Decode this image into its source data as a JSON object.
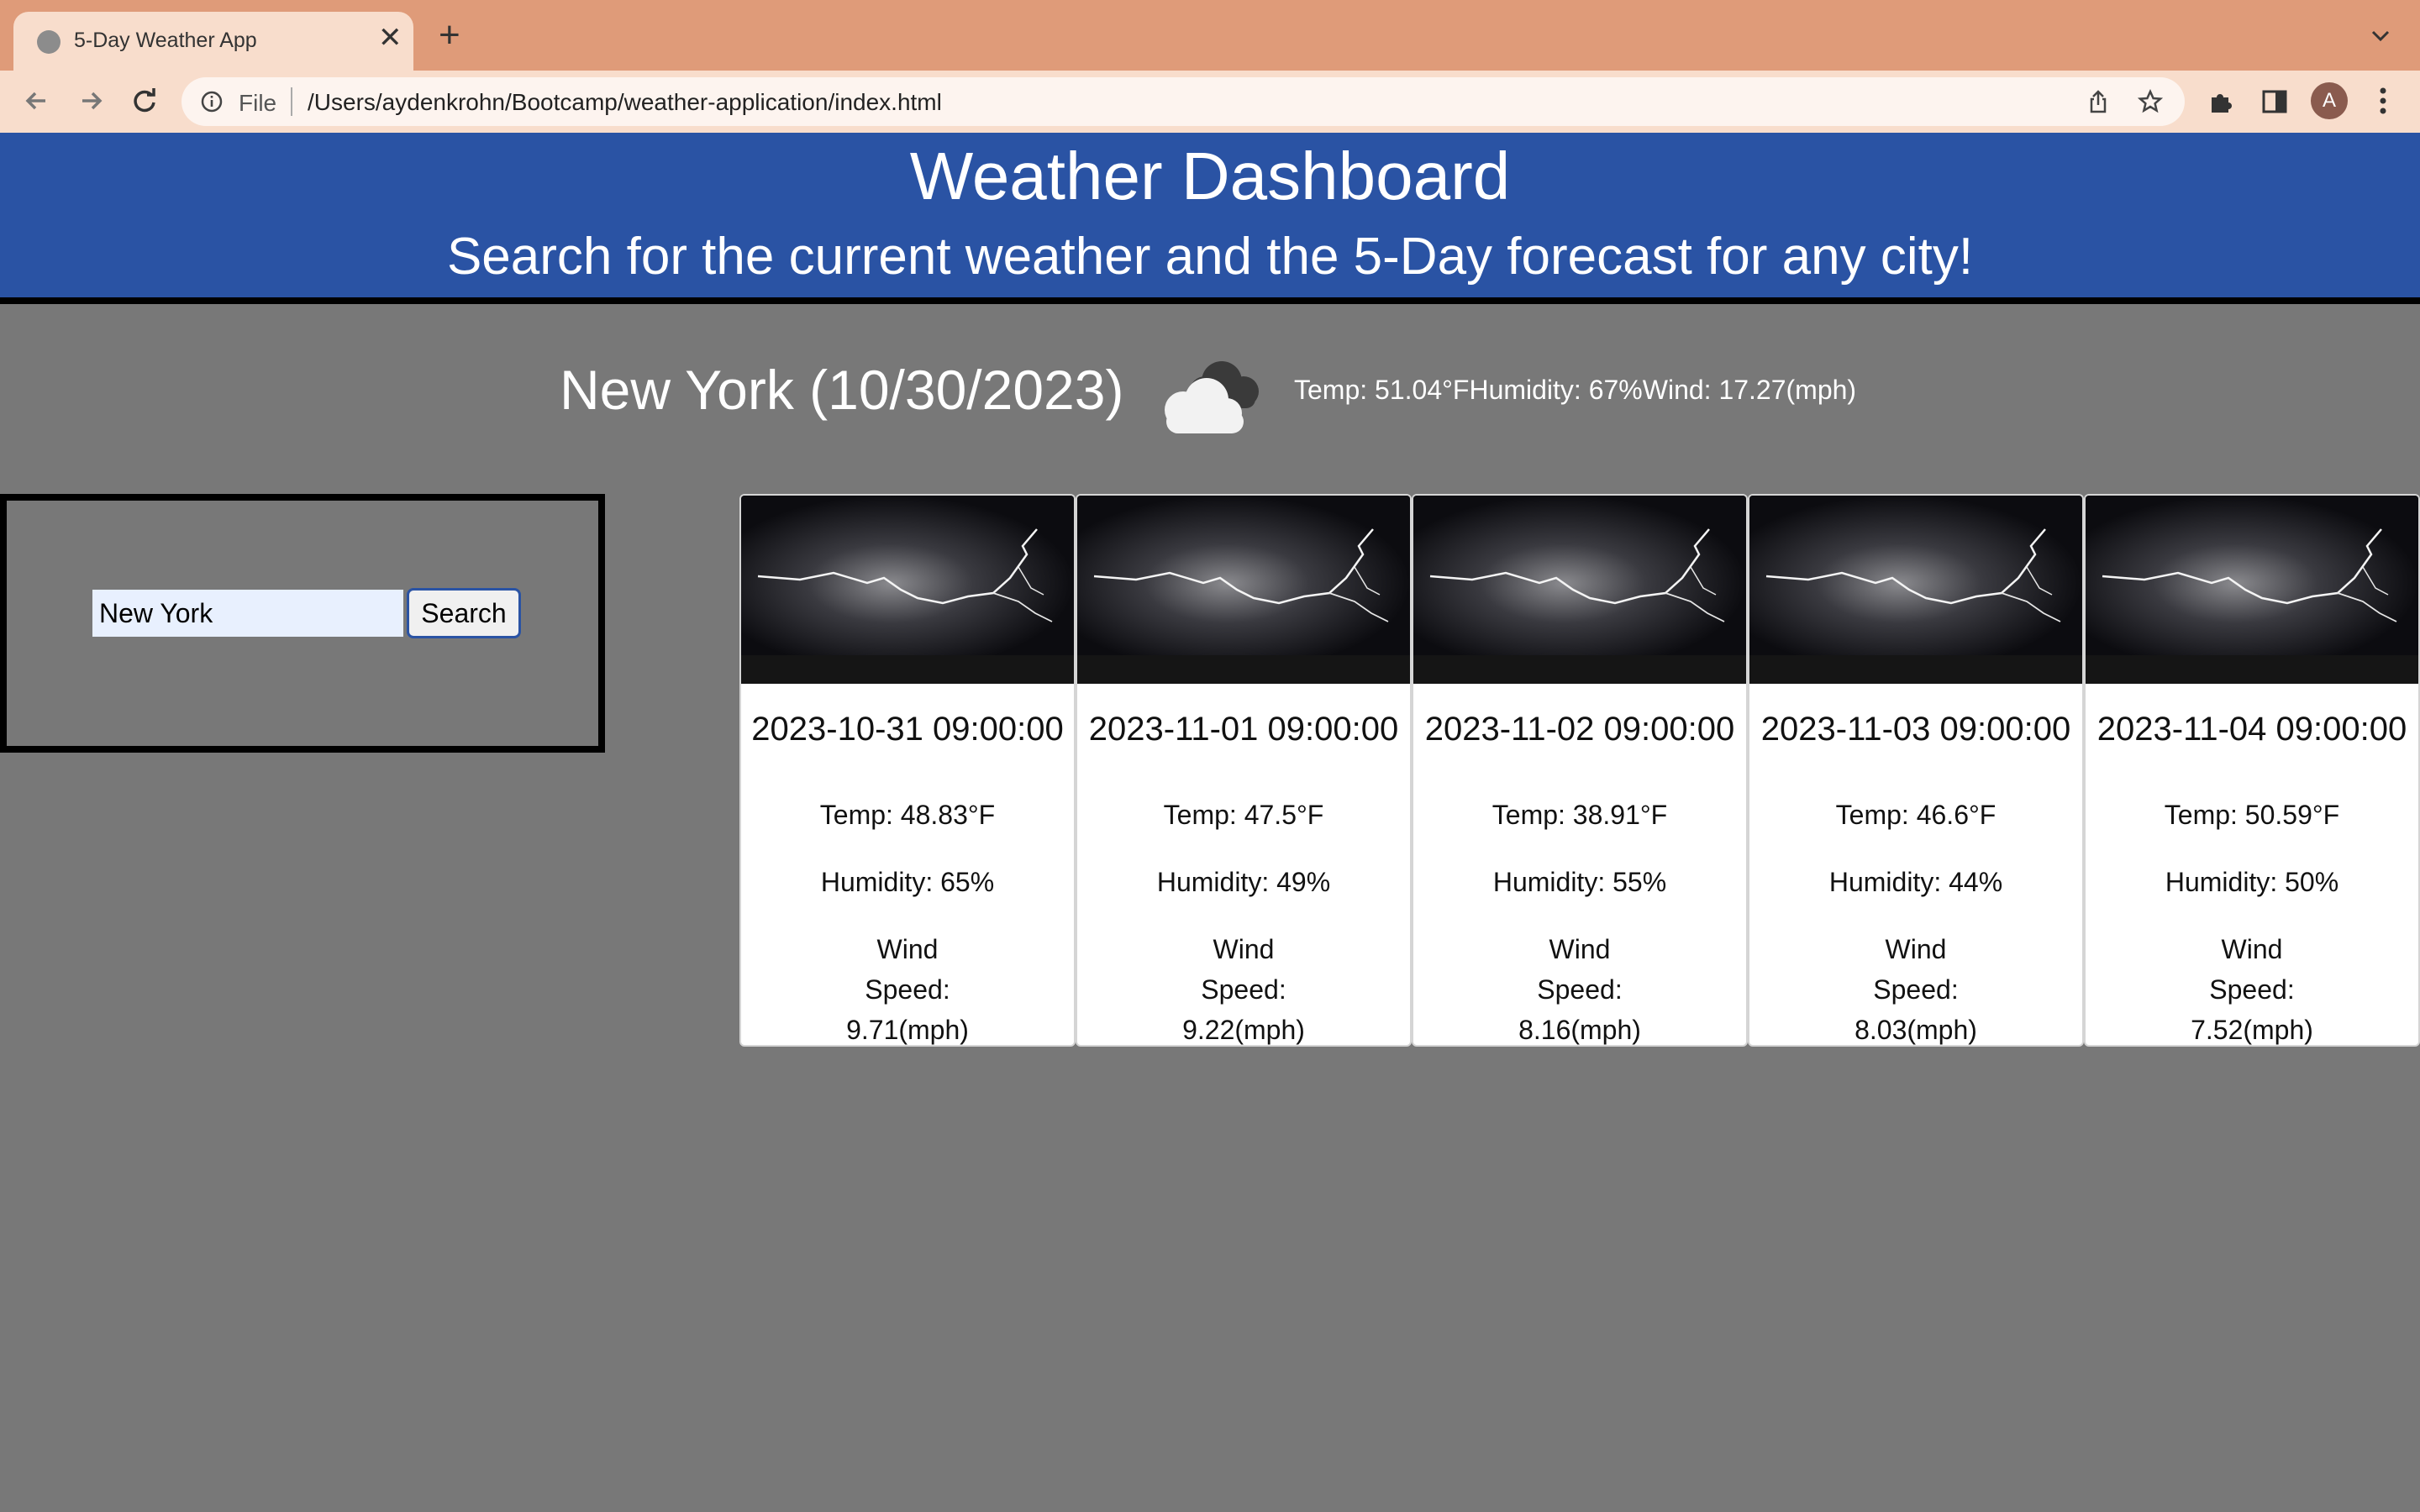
{
  "browser": {
    "tab_title": "5-Day Weather App",
    "close_glyph": "✕",
    "new_tab_glyph": "+",
    "file_label": "File",
    "url": "/Users/aydenkrohn/Bootcamp/weather-application/index.html",
    "avatar_letter": "A"
  },
  "header": {
    "title": "Weather Dashboard",
    "subtitle": "Search for the current weather and the 5-Day forecast for any city!"
  },
  "current": {
    "city_date": "New York (10/30/2023)",
    "stats": "Temp: 51.04°FHumidity: 67%Wind: 17.27(mph)",
    "icon": "cloud-icon"
  },
  "search": {
    "value": "New York",
    "button_label": "Search"
  },
  "forecast": [
    {
      "date": "2023-10-31 09:00:00",
      "temp": "Temp: 48.83°F",
      "humidity": "Humidity: 65%",
      "wind": "Wind Speed: 9.71(mph)"
    },
    {
      "date": "2023-11-01 09:00:00",
      "temp": "Temp: 47.5°F",
      "humidity": "Humidity: 49%",
      "wind": "Wind Speed: 9.22(mph)"
    },
    {
      "date": "2023-11-02 09:00:00",
      "temp": "Temp: 38.91°F",
      "humidity": "Humidity: 55%",
      "wind": "Wind Speed: 8.16(mph)"
    },
    {
      "date": "2023-11-03 09:00:00",
      "temp": "Temp: 46.6°F",
      "humidity": "Humidity: 44%",
      "wind": "Wind Speed: 8.03(mph)"
    },
    {
      "date": "2023-11-04 09:00:00",
      "temp": "Temp: 50.59°F",
      "humidity": "Humidity: 50%",
      "wind": "Wind Speed: 7.52(mph)"
    }
  ],
  "colors": {
    "header_bg": "#2a53a4",
    "page_bg": "#787878",
    "tabstrip_bg": "#df9b79"
  }
}
